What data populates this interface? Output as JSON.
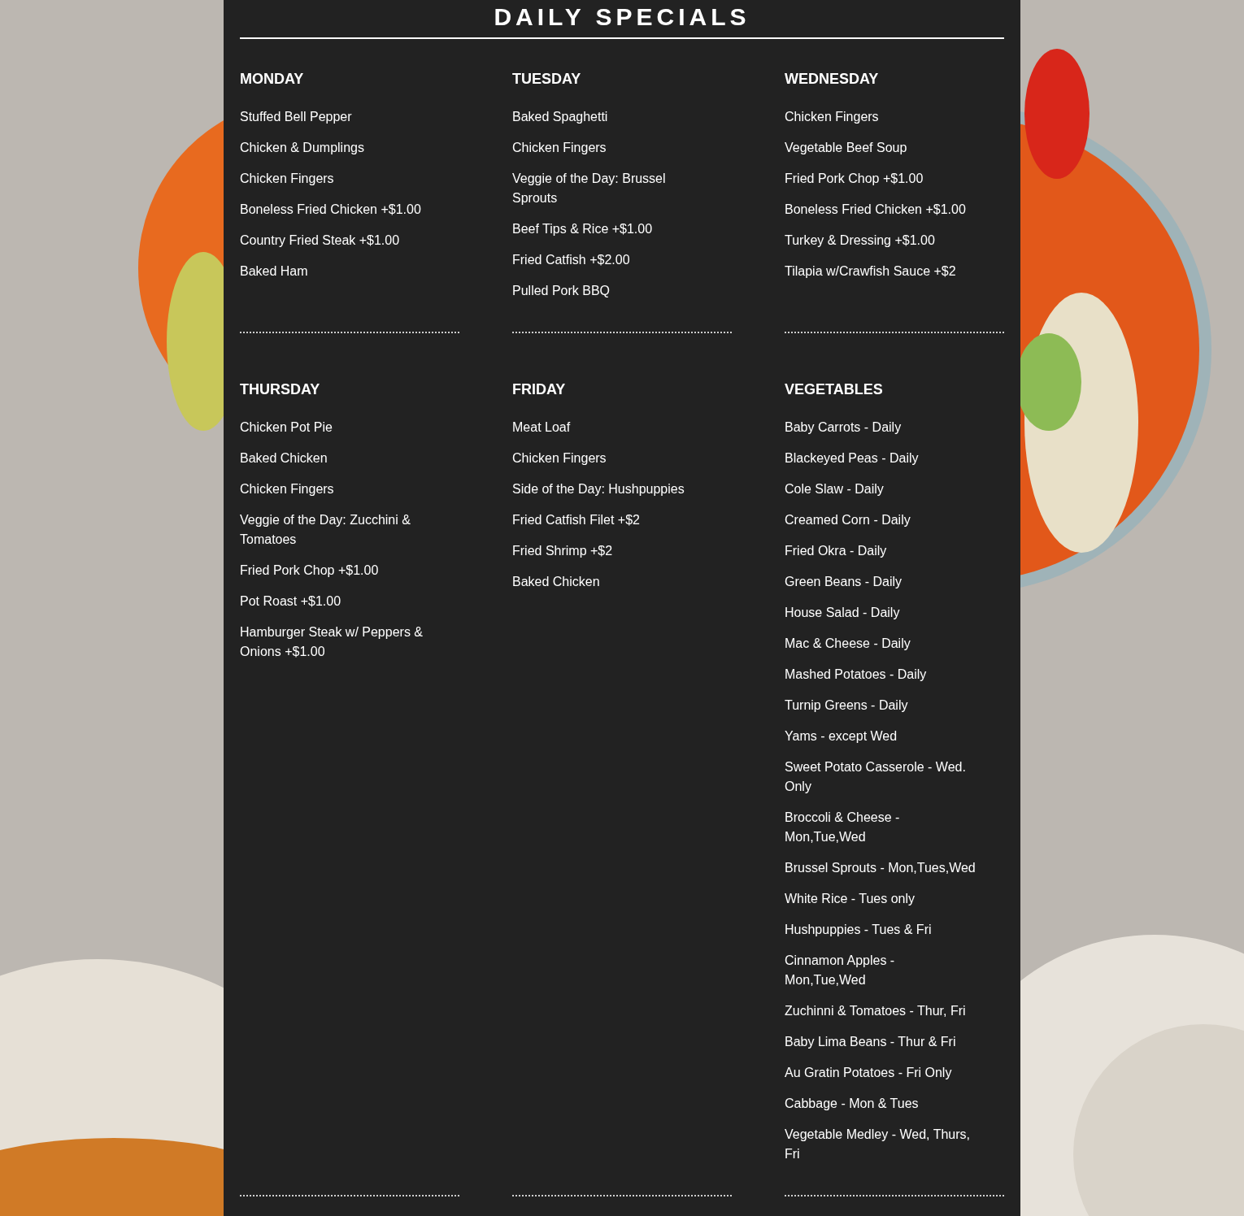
{
  "title": "DAILY SPECIALS",
  "sections": [
    {
      "heading": "MONDAY",
      "items": [
        "Stuffed Bell Pepper",
        "Chicken & Dumplings",
        "Chicken Fingers",
        "Boneless Fried Chicken +$1.00",
        "Country Fried Steak +$1.00",
        "Baked Ham"
      ]
    },
    {
      "heading": "TUESDAY",
      "items": [
        "Baked Spaghetti",
        "Chicken Fingers",
        "Veggie of the Day: Brussel Sprouts",
        "Beef Tips & Rice +$1.00",
        "Fried Catfish +$2.00",
        "Pulled Pork BBQ"
      ]
    },
    {
      "heading": "WEDNESDAY",
      "items": [
        "Chicken Fingers",
        "Vegetable Beef Soup",
        "Fried Pork Chop +$1.00",
        "Boneless Fried Chicken +$1.00",
        "Turkey & Dressing +$1.00",
        "Tilapia w/Crawfish Sauce +$2"
      ]
    },
    {
      "heading": "THURSDAY",
      "items": [
        "Chicken Pot Pie",
        "Baked Chicken",
        "Chicken Fingers",
        "Veggie of the Day: Zucchini & Tomatoes",
        "Fried Pork Chop +$1.00",
        "Pot Roast +$1.00",
        "Hamburger Steak w/ Peppers & Onions +$1.00"
      ]
    },
    {
      "heading": "FRIDAY",
      "items": [
        "Meat Loaf",
        "Chicken Fingers",
        "Side of the Day: Hushpuppies",
        "Fried Catfish Filet +$2",
        "Fried Shrimp +$2",
        "Baked Chicken"
      ]
    },
    {
      "heading": "VEGETABLES",
      "items": [
        "Baby Carrots - Daily",
        "Blackeyed Peas - Daily",
        "Cole Slaw - Daily",
        "Creamed Corn - Daily",
        "Fried Okra - Daily",
        "Green Beans - Daily",
        "House Salad - Daily",
        "Mac & Cheese - Daily",
        "Mashed Potatoes - Daily",
        "Turnip Greens - Daily",
        "Yams - except Wed",
        "Sweet Potato Casserole - Wed. Only",
        "Broccoli & Cheese - Mon,Tue,Wed",
        "Brussel Sprouts - Mon,Tues,Wed",
        "White Rice - Tues only",
        "Hushpuppies - Tues & Fri",
        "Cinnamon Apples - Mon,Tue,Wed",
        "Zuchinni & Tomatoes - Thur, Fri",
        "Baby Lima Beans - Thur & Fri",
        "Au Gratin Potatoes - Fri Only",
        "Cabbage - Mon & Tues",
        "Vegetable Medley - Wed, Thurs, Fri"
      ]
    }
  ]
}
